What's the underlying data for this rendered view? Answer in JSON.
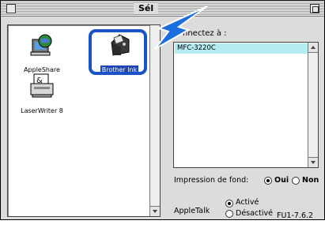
{
  "window": {
    "title": "Sél",
    "close_icon": "close-box-icon",
    "zoom_icon": "zoom-box-icon"
  },
  "devices": [
    {
      "label": "AppleShare",
      "icon": "appleshare-icon"
    },
    {
      "label": "Brother Ink",
      "icon": "printer-icon",
      "selected": true
    },
    {
      "label": "LaserWriter 8",
      "icon": "laserwriter-icon"
    }
  ],
  "connect": {
    "label": "nnectez à :",
    "ports": [
      "MFC-3220C"
    ]
  },
  "background_printing": {
    "label": "Impression de fond:",
    "options": [
      {
        "label": "Oui",
        "selected": true
      },
      {
        "label": "Non",
        "selected": false
      }
    ]
  },
  "appletalk": {
    "label": "AppleTalk",
    "options": [
      {
        "label": "Activé",
        "selected": true
      },
      {
        "label": "Désactivé",
        "selected": false
      }
    ]
  },
  "caption": "FU1-7.6.2",
  "colors": {
    "highlight_border": "#1a52c8",
    "selection": "#1e46b4",
    "port_selection": "#b4ecf2",
    "arrow": "#1a6ee0"
  }
}
